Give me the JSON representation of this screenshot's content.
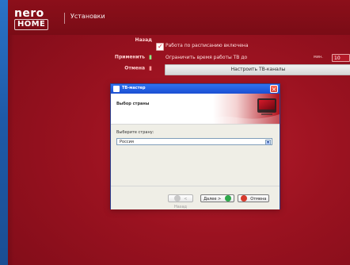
{
  "app": {
    "logo": {
      "nero": "nero",
      "home": "HOME"
    },
    "section_title": "Установки"
  },
  "nav": {
    "back": "Назад",
    "apply": "Применить",
    "cancel": "Отмена"
  },
  "settings": {
    "schedule_label": "Работа по расписанию включена",
    "limit_label": "Ограничить время работы ТВ до",
    "limit_unit": "мин.",
    "limit_value": "10",
    "tv_button": "Настроить ТВ-каналы"
  },
  "wizard": {
    "title": "ТВ-мастер",
    "heading": "Выбор страны",
    "choose_label": "Выберите страну:",
    "selected_country": "Россия",
    "buttons": {
      "back": "< Назад",
      "next": "Далее >",
      "cancel": "Отмена"
    }
  },
  "colors": {
    "brand_red": "#9a1220",
    "xp_blue": "#1b4fd2",
    "xp_window": "#efeee6"
  },
  "icons": {
    "check": "checkmark-icon",
    "close": "close-icon"
  }
}
